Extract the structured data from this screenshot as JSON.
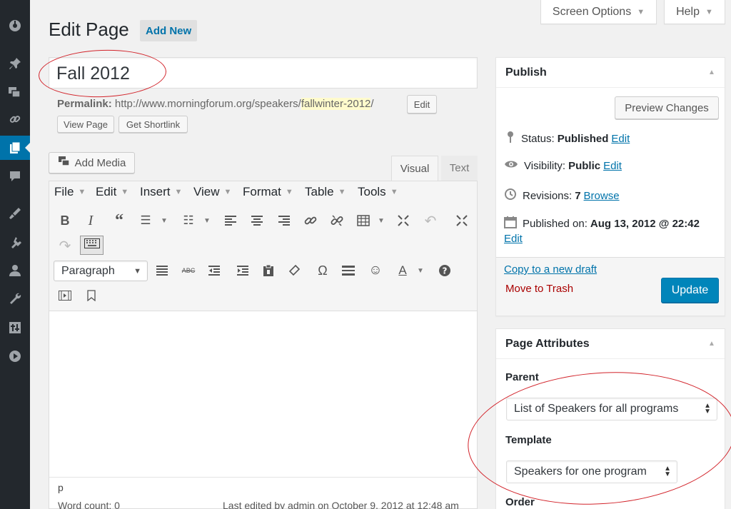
{
  "sidebar": {
    "icons": [
      "dashboard-icon",
      "pin-icon",
      "media-icon",
      "links-icon",
      "pages-icon",
      "comments-icon",
      "appearance-icon",
      "plugins-icon",
      "users-icon",
      "tools-icon",
      "settings-icon",
      "play-icon"
    ]
  },
  "screen_options": {
    "screen_options_label": "Screen Options",
    "help_label": "Help"
  },
  "header": {
    "title": "Edit Page",
    "add_new_label": "Add New"
  },
  "post": {
    "title_value": "Fall 2012",
    "permalink_label": "Permalink:",
    "permalink_base": "http://www.morningforum.org/speakers/",
    "permalink_slug": "fallwinter-2012",
    "permalink_tail": "/",
    "edit_label": "Edit",
    "view_page_label": "View Page",
    "shortlink_label": "Get Shortlink"
  },
  "editor": {
    "add_media_label": "Add Media",
    "tab_visual": "Visual",
    "tab_text": "Text",
    "menus": [
      "File",
      "Edit",
      "Insert",
      "View",
      "Format",
      "Table",
      "Tools"
    ],
    "format_select": "Paragraph",
    "path": "p",
    "word_count": "Word count: 0",
    "last_edited": "Last edited by admin on October 9, 2012 at 12:48 am"
  },
  "publish": {
    "title": "Publish",
    "preview_label": "Preview Changes",
    "status_label": "Status:",
    "status_value": "Published",
    "visibility_label": "Visibility:",
    "visibility_value": "Public",
    "revisions_label": "Revisions:",
    "revisions_value": "7",
    "browse_label": "Browse",
    "published_label": "Published on:",
    "published_value": "Aug 13, 2012 @ 22:42",
    "edit_label": "Edit",
    "copy_draft_label": "Copy to a new draft",
    "trash_label": "Move to Trash",
    "update_label": "Update"
  },
  "attributes": {
    "title": "Page Attributes",
    "parent_label": "Parent",
    "parent_value": "List of Speakers for all programs",
    "template_label": "Template",
    "template_value": "Speakers for one program",
    "order_label": "Order"
  },
  "colors": {
    "accent": "#0073aa",
    "update_button": "#0085ba",
    "trash": "#a00",
    "annotation": "#d2232a",
    "slug_highlight": "#fffbcc"
  }
}
